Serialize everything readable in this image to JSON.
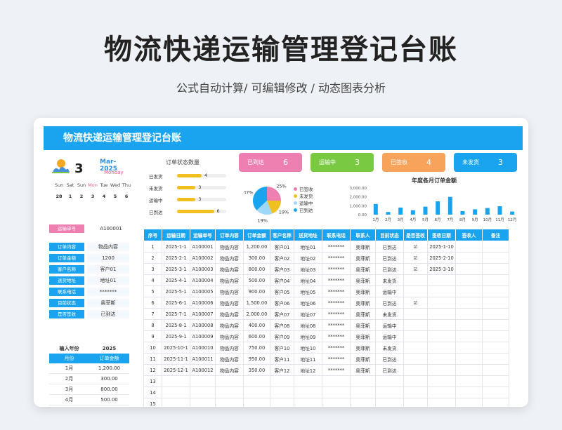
{
  "hero": {
    "title": "物流快递运输管理登记台账",
    "subtitle": "公式自动计算/ 可编辑修改 / 动态图表分析"
  },
  "banner": {
    "title": "物流快递运输管理登记台账"
  },
  "calendar": {
    "day": "3",
    "month": "Mar-2025",
    "weekday": "Monday",
    "week": [
      "Sun",
      "Sat",
      "Sun",
      "Mon",
      "Tue",
      "Wed",
      "Thu"
    ],
    "dates": [
      "28",
      "1",
      "2",
      "3",
      "4",
      "5",
      "6"
    ]
  },
  "status": {
    "title": "订单状态数量",
    "rows": [
      {
        "label": "已发货",
        "value": "4",
        "count": 4
      },
      {
        "label": "未发货",
        "value": "3",
        "count": 3
      },
      {
        "label": "运输中",
        "value": "3",
        "count": 3
      },
      {
        "label": "已到达",
        "value": "6",
        "count": 6
      }
    ],
    "max": 8
  },
  "kpis": [
    {
      "label": "已到达",
      "value": "6",
      "color": "#ee7fb1"
    },
    {
      "label": "运输中",
      "value": "3",
      "color": "#7ac943"
    },
    {
      "label": "已签收",
      "value": "4",
      "color": "#f7a35c"
    },
    {
      "label": "未发货",
      "value": "3",
      "color": "#1aa3ee"
    }
  ],
  "pie": {
    "slices": [
      {
        "label": "已签收",
        "value": 25,
        "text": "25%",
        "color": "#ee7fb1"
      },
      {
        "label": "未发货",
        "value": 19,
        "text": "19%",
        "color": "#f0c020"
      },
      {
        "label": "运输中",
        "value": 19,
        "text": "19%",
        "color": "#9fd8f7"
      },
      {
        "label": "已到达",
        "value": 37,
        "text": "37%",
        "color": "#1aa3ee"
      }
    ]
  },
  "chart_data": {
    "type": "bar",
    "title": "年度各月订单金额",
    "categories": [
      "1月",
      "2月",
      "3月",
      "4月",
      "5月",
      "6月",
      "7月",
      "8月",
      "9月",
      "10月",
      "11月",
      "12月"
    ],
    "values": [
      1200,
      300,
      800,
      500,
      900,
      1500,
      2000,
      400,
      600,
      750,
      950,
      350
    ],
    "yticks": [
      "3,000.00",
      "2,000.00",
      "1,000.00",
      "0.00"
    ],
    "ylim": [
      0,
      3000
    ],
    "color": "#1aa3ee"
  },
  "info": {
    "order_no_label": "运输单号",
    "order_no": "A100001",
    "rows": [
      {
        "label": "订单内容",
        "value": "物品内容"
      },
      {
        "label": "订单金额",
        "value": "1200"
      },
      {
        "label": "客户名称",
        "value": "客户01"
      },
      {
        "label": "送货地址",
        "value": "地址01"
      },
      {
        "label": "联系电话",
        "value": "*******"
      },
      {
        "label": "目前状态",
        "value": "奥菲斯"
      },
      {
        "label": "是否签收",
        "value": "已到达"
      }
    ]
  },
  "year_table": {
    "input_label": "输入年份",
    "year": "2025",
    "headers": [
      "月份",
      "订单金额"
    ],
    "rows": [
      [
        "1月",
        "1,200.00"
      ],
      [
        "2月",
        "300.00"
      ],
      [
        "3月",
        "800.00"
      ],
      [
        "4月",
        "500.00"
      ]
    ]
  },
  "table": {
    "headers": [
      "序号",
      "运输日期",
      "运输单号",
      "订单内容",
      "订单金额",
      "客户名称",
      "送货地址",
      "联系电话",
      "联系人",
      "目前状态",
      "是否签收",
      "签收日期",
      "签收人",
      "备注"
    ],
    "rows": [
      [
        "1",
        "2025-1-1",
        "A100001",
        "物品内容",
        "1,200.00",
        "客户01",
        "地址01",
        "*******",
        "奥菲斯",
        "已到达",
        "☑",
        "2025-1-10",
        "",
        ""
      ],
      [
        "2",
        "2025-2-1",
        "A100002",
        "物品内容",
        "300.00",
        "客户02",
        "地址02",
        "*******",
        "奥菲斯",
        "已到达",
        "☑",
        "2025-2-10",
        "",
        ""
      ],
      [
        "3",
        "2025-3-1",
        "A100003",
        "物品内容",
        "800.00",
        "客户03",
        "地址03",
        "*******",
        "奥菲斯",
        "已到达",
        "☑",
        "2025-3-10",
        "",
        ""
      ],
      [
        "4",
        "2025-4-1",
        "A100004",
        "物品内容",
        "500.00",
        "客户04",
        "地址04",
        "*******",
        "奥菲斯",
        "未发货",
        "",
        "",
        "",
        ""
      ],
      [
        "5",
        "2025-5-1",
        "A100005",
        "物品内容",
        "900.00",
        "客户05",
        "地址05",
        "*******",
        "奥菲斯",
        "运输中",
        "",
        "",
        "",
        ""
      ],
      [
        "6",
        "2025-6-1",
        "A100006",
        "物品内容",
        "1,500.00",
        "客户06",
        "地址06",
        "*******",
        "奥菲斯",
        "已到达",
        "☑",
        "",
        "",
        ""
      ],
      [
        "7",
        "2025-7-1",
        "A100007",
        "物品内容",
        "2,000.00",
        "客户07",
        "地址07",
        "*******",
        "奥菲斯",
        "未发货",
        "",
        "",
        "",
        ""
      ],
      [
        "8",
        "2025-8-1",
        "A100008",
        "物品内容",
        "400.00",
        "客户08",
        "地址08",
        "*******",
        "奥菲斯",
        "运输中",
        "",
        "",
        "",
        ""
      ],
      [
        "9",
        "2025-9-1",
        "A100009",
        "物品内容",
        "600.00",
        "客户09",
        "地址09",
        "*******",
        "奥菲斯",
        "运输中",
        "",
        "",
        "",
        ""
      ],
      [
        "10",
        "2025-10-1",
        "A100010",
        "物品内容",
        "750.00",
        "客户10",
        "地址10",
        "*******",
        "奥菲斯",
        "未发货",
        "",
        "",
        "",
        ""
      ],
      [
        "11",
        "2025-11-1",
        "A100011",
        "物品内容",
        "950.00",
        "客户11",
        "地址11",
        "*******",
        "奥菲斯",
        "已到达",
        "",
        "",
        "",
        ""
      ],
      [
        "12",
        "2025-12-1",
        "A100012",
        "物品内容",
        "350.00",
        "客户12",
        "地址12",
        "*******",
        "奥菲斯",
        "已到达",
        "",
        "",
        "",
        ""
      ],
      [
        "13",
        "",
        "",
        "",
        "",
        "",
        "",
        "",
        "",
        "",
        "",
        "",
        "",
        ""
      ],
      [
        "14",
        "",
        "",
        "",
        "",
        "",
        "",
        "",
        "",
        "",
        "",
        "",
        "",
        ""
      ],
      [
        "15",
        "",
        "",
        "",
        "",
        "",
        "",
        "",
        "",
        "",
        "",
        "",
        "",
        ""
      ]
    ]
  }
}
